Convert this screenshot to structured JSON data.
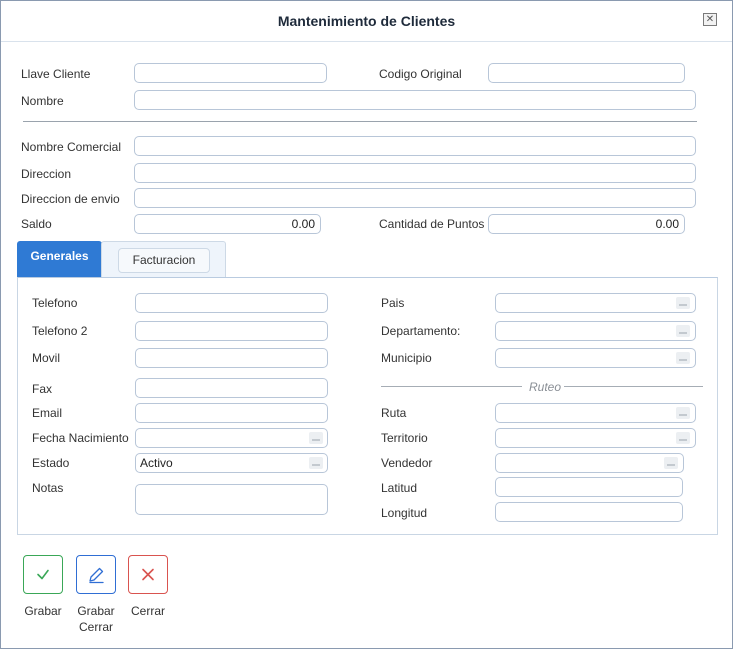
{
  "dialog": {
    "title": "Mantenimiento de Clientes"
  },
  "header": {
    "llave_cliente_label": "Llave Cliente",
    "codigo_original_label": "Codigo Original",
    "nombre_label": "Nombre",
    "nombre_comercial_label": "Nombre Comercial",
    "direccion_label": "Direccion",
    "direccion_envio_label": "Direccion de envio",
    "saldo_label": "Saldo",
    "saldo_value": "0.00",
    "cantidad_puntos_label": "Cantidad de Puntos",
    "cantidad_puntos_value": "0.00"
  },
  "tabs": [
    "Generales",
    "Facturacion"
  ],
  "generales": {
    "telefono_label": "Telefono",
    "telefono2_label": "Telefono 2",
    "movil_label": "Movil",
    "fax_label": "Fax",
    "email_label": "Email",
    "fecha_nacimiento_label": "Fecha Nacimiento",
    "estado_label": "Estado",
    "estado_value": "Activo",
    "notas_label": "Notas",
    "pais_label": "Pais",
    "departamento_label": "Departamento:",
    "municipio_label": "Municipio",
    "ruteo_label": "Ruteo",
    "ruta_label": "Ruta",
    "territorio_label": "Territorio",
    "vendedor_label": "Vendedor",
    "latitud_label": "Latitud",
    "longitud_label": "Longitud"
  },
  "actions": {
    "grabar_label": "Grabar",
    "grabar_cerrar_label_1": "Grabar",
    "grabar_cerrar_label_2": "Cerrar",
    "cerrar_label": "Cerrar"
  },
  "colors": {
    "accent": "#2f7ad4",
    "save_green": "#3aa757",
    "edit_blue": "#2f6ed4",
    "close_red": "#d9534f"
  },
  "icons": {
    "close": "close-icon",
    "grabar": "check-icon",
    "grabar_cerrar": "pencil-icon",
    "cerrar": "x-icon"
  }
}
